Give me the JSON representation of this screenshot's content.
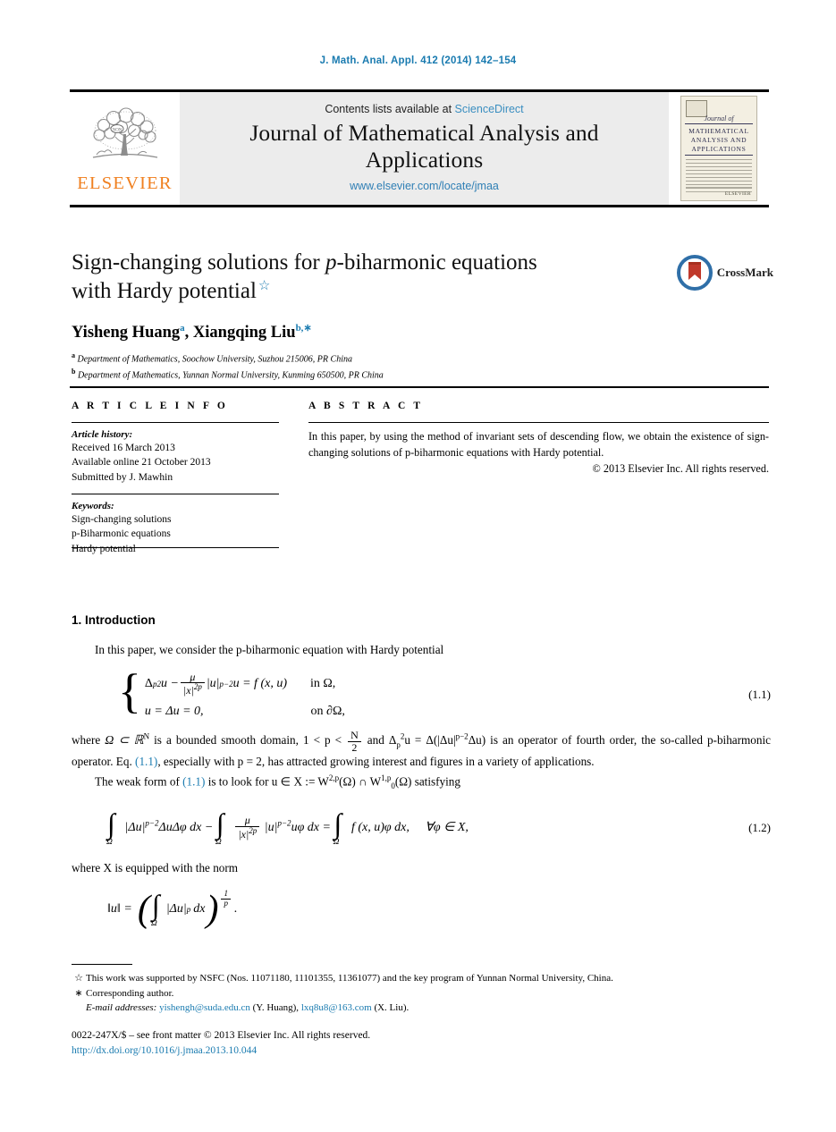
{
  "running_head": "J. Math. Anal. Appl. 412 (2014) 142–154",
  "masthead": {
    "publisher_name": "ELSEVIER",
    "contents_prefix": "Contents lists available at",
    "contents_link": "ScienceDirect",
    "journal_title_line1": "Journal of Mathematical Analysis and",
    "journal_title_line2": "Applications",
    "journal_url": "www.elsevier.com/locate/jmaa",
    "cover": {
      "jof": "Journal of",
      "band_line1": "MATHEMATICAL",
      "band_line2": "ANALYSIS AND",
      "band_line3": "APPLICATIONS",
      "publisher": "ELSEVIER"
    }
  },
  "article": {
    "title_part1": "Sign-changing solutions for ",
    "title_italic": "p",
    "title_part2": "-biharmonic equations",
    "title_line2": "with Hardy potential",
    "title_footnote_mark": "☆",
    "authors": "Yisheng Huang",
    "author_sup_a": "a",
    "authors_sep": ", ",
    "author2": "Xiangqing Liu",
    "author_sup_b": "b,",
    "author_sup_star": "∗",
    "affiliation_a_mark": "a",
    "affiliation_a": "Department of Mathematics, Soochow University, Suzhou 215006, PR China",
    "affiliation_b_mark": "b",
    "affiliation_b": "Department of Mathematics, Yunnan Normal University, Kunming 650500, PR China",
    "crossmark_label": "CrossMark"
  },
  "info": {
    "heading": "A R T I C L E   I N F O",
    "history_label": "Article history:",
    "received": "Received 16 March 2013",
    "available": "Available online 21 October 2013",
    "submitted": "Submitted by J. Mawhin",
    "keywords_label": "Keywords:",
    "keywords": [
      "Sign-changing solutions",
      "p-Biharmonic equations",
      "Hardy potential"
    ]
  },
  "abstract": {
    "heading": "A B S T R A C T",
    "text": "In this paper, by using the method of invariant sets of descending flow, we obtain the existence of sign-changing solutions of p-biharmonic equations with Hardy potential.",
    "copyright": "© 2013 Elsevier Inc. All rights reserved."
  },
  "body": {
    "section_heading": "1. Introduction",
    "para1": "In this paper, we consider the p-biharmonic equation with Hardy potential",
    "eq1": {
      "number": "(1.1)",
      "line1_lhs_op": "Δ",
      "line1_sub": "p",
      "line1_sup": "2",
      "line1_u": "u −",
      "frac_num": "μ",
      "frac_den_base": "|x|",
      "frac_den_exp": "2p",
      "line1_mid": "|u|",
      "line1_mid_exp": "p−2",
      "line1_rest": "u = f (x, u)",
      "line1_cond": "in Ω,",
      "line2": "u = Δu = 0,",
      "line2_cond": "on ∂Ω,"
    },
    "para2_a": "where ",
    "para2_b": "Ω ⊂ ℝ",
    "para2_sup": "N",
    "para2_c": " is a bounded smooth domain, 1 < p < ",
    "para2_frac_num": "N",
    "para2_frac_den": "2",
    "para2_d": " and Δ",
    "para2_e": "u = Δ(|Δu|",
    "para2_f": "Δu) is an operator of fourth order, the so-called p-biharmonic operator. Eq. ",
    "para2_link": "(1.1)",
    "para2_g": ", especially with p = 2, has attracted growing interest and figures in a variety of applications.",
    "para3_a": "The weak form of ",
    "para3_link": "(1.1)",
    "para3_b": " is to look for u ∈ X := W",
    "para3_sup1": "2,p",
    "para3_c": "(Ω) ∩ W",
    "para3_sup2": "1,p",
    "para3_sub2": "0",
    "para3_d": "(Ω) satisfying",
    "eq2": {
      "number": "(1.2)",
      "int_limit": "Ω",
      "t1": "|Δu|",
      "t1_exp": "p−2",
      "t2": "ΔuΔφ dx −",
      "frac_num": "μ",
      "frac_den_base": "|x|",
      "frac_den_exp": "2p",
      "t3": "|u|",
      "t3_exp": "p−2",
      "t4": "uφ dx =",
      "t5": "f (x, u)φ dx,",
      "t6": "∀φ ∈ X,"
    },
    "para4": "where X is equipped with the norm",
    "eq3": {
      "lhs": "‖u‖ =",
      "int_limit": "Ω",
      "inner": "|Δu|",
      "inner_exp": "p",
      "inner_dx": "dx",
      "power_num": "1",
      "power_den": "p",
      "period": "."
    }
  },
  "footnotes": {
    "star_mark": "☆",
    "star_text": "This work was supported by NSFC (Nos. 11071180, 11101355, 11361077) and the key program of Yunnan Normal University, China.",
    "corr_mark": "∗",
    "corr_text": "Corresponding author.",
    "email_label": "E-mail addresses:",
    "email1": "yishengh@suda.edu.cn",
    "email1_owner": "(Y. Huang),",
    "email2": "lxq8u8@163.com",
    "email2_owner": "(X. Liu)."
  },
  "colophon": {
    "issn_line": "0022-247X/$ – see front matter © 2013 Elsevier Inc. All rights reserved.",
    "doi": "http://dx.doi.org/10.1016/j.jmaa.2013.10.044"
  },
  "colors": {
    "link_blue": "#1a7bb0",
    "elsevier_orange": "#F08020",
    "masthead_gray": "#ececec"
  }
}
